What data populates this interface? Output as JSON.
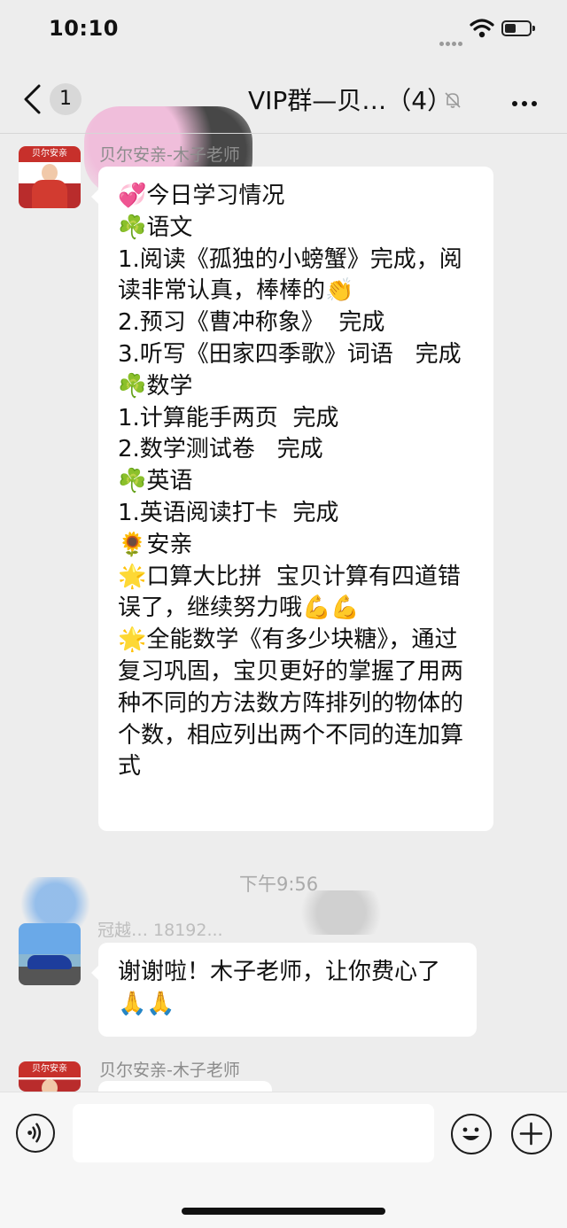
{
  "status_bar": {
    "time": "10:10"
  },
  "nav": {
    "back_count": "1",
    "title": "VIP群—贝…（4）"
  },
  "messages": [
    {
      "sender": "贝尔安亲-木子老师",
      "avatar_logo": "贝尔安亲",
      "text": "💞今日学习情况\n☘️语文\n1.阅读《孤独的小螃蟹》完成，阅读非常认真，棒棒的👏\n2.预习《曹冲称象》  完成\n3.听写《田家四季歌》词语   完成\n☘️数学\n1.计算能手两页  完成\n2.数学测试卷   完成\n☘️英语\n1.英语阅读打卡  完成\n🌻安亲\n🌟口算大比拼  宝贝计算有四道错误了，继续努力哦💪💪\n🌟全能数学《有多少块糖》，通过复习巩固，宝贝更好的掌握了用两种不同的方法数方阵排列的物体的个数，相应列出两个不同的连加算式"
    },
    {
      "timestamp": "下午9:56",
      "sender": "冠越… 18192...",
      "text": "谢谢啦！木子老师，让你费心了🙏🙏"
    },
    {
      "sender": "贝尔安亲-木子老师",
      "avatar_logo": "贝尔安亲",
      "text": ""
    }
  ],
  "input": {
    "placeholder": ""
  }
}
